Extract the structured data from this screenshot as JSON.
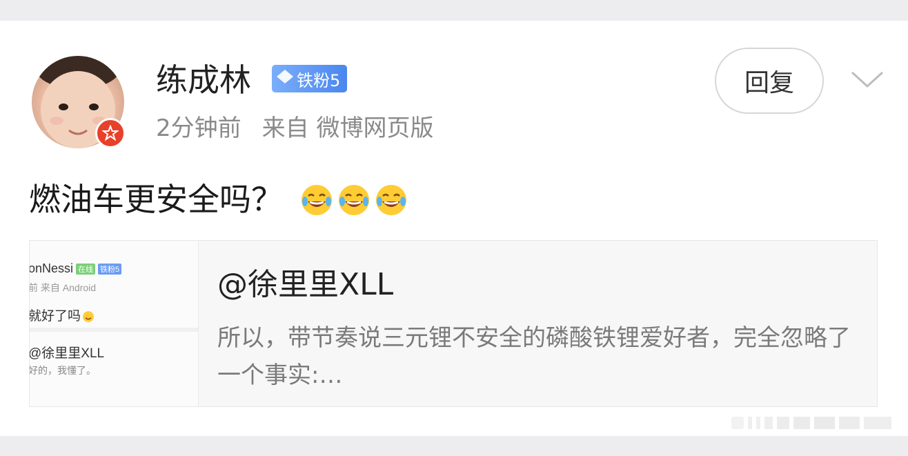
{
  "post": {
    "username": "练成林",
    "fan_badge": "铁粉5",
    "time": "2分钟前",
    "source": "来自 微博网页版",
    "content": "燃油车更安全吗？",
    "emoji_icon": "laugh-cry-emoji"
  },
  "actions": {
    "reply_label": "回复"
  },
  "quote": {
    "title": "@徐里里XLL",
    "body": "所以，带节奏说三元锂不安全的磷酸铁锂爱好者，完全忽略了一个事实:…",
    "thumb": {
      "name": "onNessi",
      "online_tag": "在线",
      "fan_tag": "铁粉5",
      "meta": "前  来自 Android",
      "text1": "就好了吗",
      "mention": "@徐里里XLL",
      "text2": "好的，我懂了。"
    }
  },
  "colors": {
    "verified_badge": "#e8402a",
    "fan_badge": "#5a92f2"
  }
}
